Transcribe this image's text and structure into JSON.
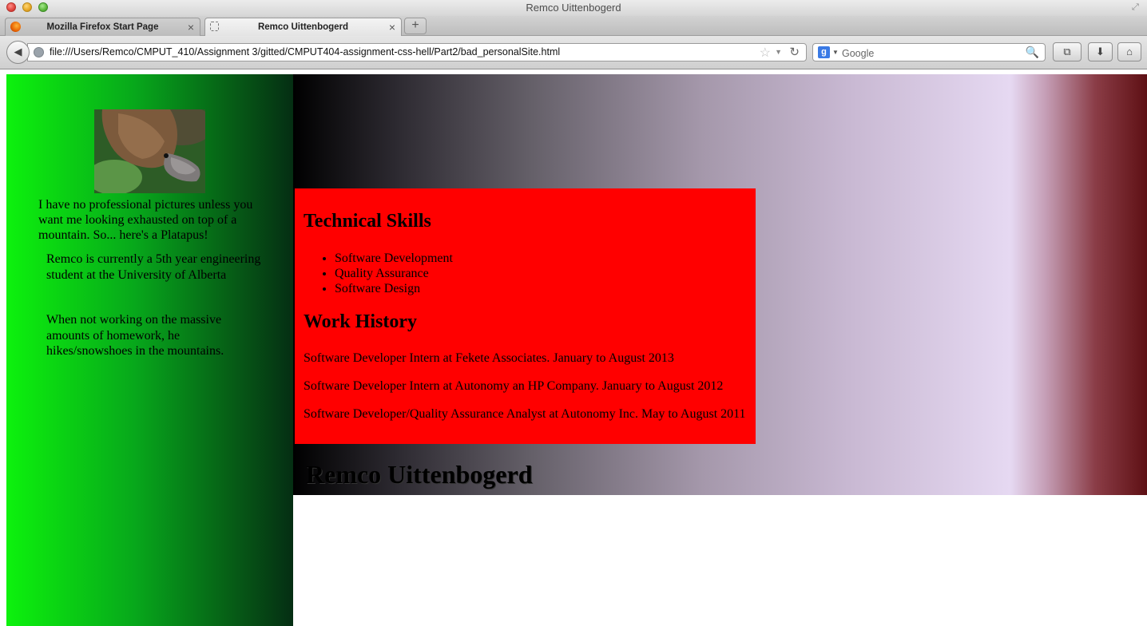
{
  "window": {
    "title": "Remco Uittenbogerd"
  },
  "tabs": [
    {
      "label": "Mozilla Firefox Start Page",
      "icon": "firefox-icon",
      "active": false
    },
    {
      "label": "Remco Uittenbogerd",
      "icon": "blank-page-icon",
      "active": true
    }
  ],
  "toolbar": {
    "url": "file:///Users/Remco/CMPUT_410/Assignment 3/gitted/CMPUT404-assignment-css-hell/Part2/bad_personalSite.html",
    "search_placeholder": "Google",
    "search_engine_icon": "g",
    "icons": {
      "back": "◀",
      "star": "☆",
      "dropmark": "▼",
      "reload": "↻",
      "magnifier": "🔍",
      "bookmarks": "⧉",
      "download": "⬇",
      "home": "⌂",
      "new_tab": "+",
      "tab_close": "×",
      "fullscreen": "⤢"
    }
  },
  "page": {
    "sidebar": {
      "photo_alt": "Platypus",
      "caption": "I have no professional pictures unless you want me looking exhausted on top of a mountain. So... here's a Platapus!",
      "bio_1": "Remco is currently a 5th year engineering student at the University of Alberta",
      "bio_2": "When not working on the massive amounts of homework, he hikes/snowshoes in the mountains."
    },
    "title": "Remco Uittenbogerd",
    "skills": {
      "heading": "Technical Skills",
      "items": [
        "Software Development",
        "Quality Assurance",
        "Software Design"
      ]
    },
    "work": {
      "heading": "Work History",
      "jobs": [
        "Software Developer Intern at Fekete Associates. January to August 2013",
        "Software Developer Intern at Autonomy an HP Company. January to August 2012",
        "Software Developer/Quality Assurance Analyst at Autonomy Inc. May to August 2011"
      ]
    },
    "colors": {
      "sidebar_start": "#0df20d",
      "sidebar_end": "#052e13",
      "content_box": "#ff0000",
      "header_band_start": "#000000",
      "header_band_mid": "#e6d9f2",
      "header_band_end": "#5e1014"
    }
  }
}
